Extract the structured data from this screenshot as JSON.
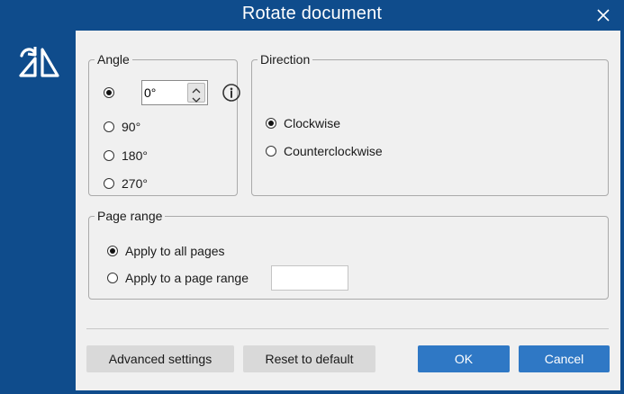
{
  "window": {
    "title": "Rotate document"
  },
  "icons": {
    "close": "close-icon",
    "app": "rotate-document-icon",
    "info": "info-icon"
  },
  "colors": {
    "titlebar": "#0f4c8c",
    "content": "#f0f0f0",
    "primary_button": "#2f78c5",
    "secondary_button": "#d9d9d9"
  },
  "angle": {
    "legend": "Angle",
    "custom_value": "0°",
    "options": [
      {
        "label": "90°",
        "checked": false
      },
      {
        "label": "180°",
        "checked": false
      },
      {
        "label": "270°",
        "checked": false
      }
    ],
    "custom_checked": true
  },
  "direction": {
    "legend": "Direction",
    "options": [
      {
        "label": "Clockwise",
        "checked": true
      },
      {
        "label": "Counterclockwise",
        "checked": false
      }
    ]
  },
  "page_range": {
    "legend": "Page range",
    "options": [
      {
        "label": "Apply to all pages",
        "checked": true
      },
      {
        "label": "Apply to a page range",
        "checked": false
      }
    ],
    "range_value": ""
  },
  "buttons": {
    "advanced": "Advanced settings",
    "reset": "Reset to default",
    "ok": "OK",
    "cancel": "Cancel"
  }
}
